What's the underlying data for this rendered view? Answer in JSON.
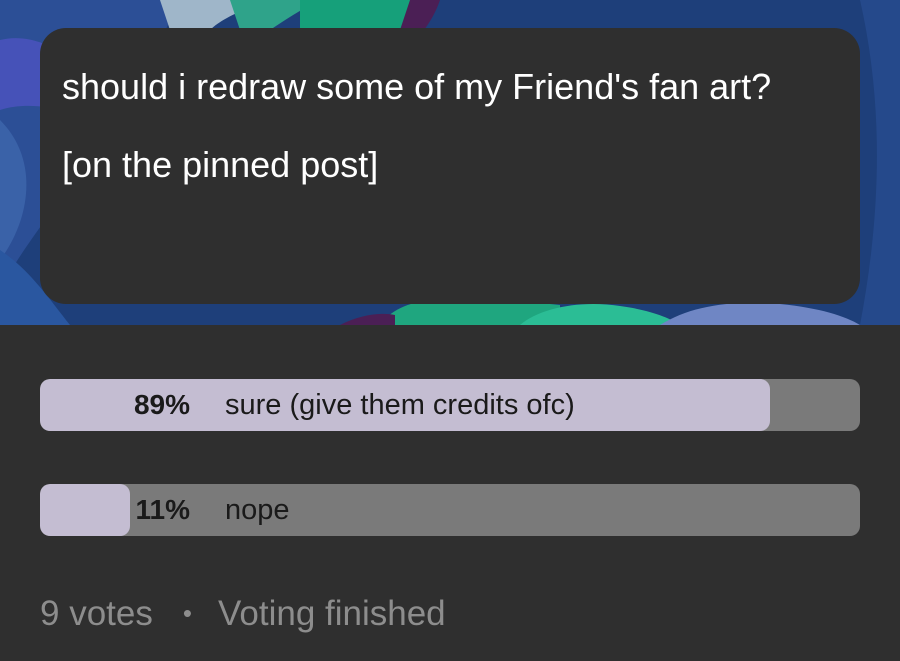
{
  "post": {
    "question": "should i redraw some of my Friend's fan art?",
    "note": "[on the pinned post]"
  },
  "poll": {
    "options": [
      {
        "percent_label": "89%",
        "label": "sure (give them credits ofc)",
        "fraction": 0.89
      },
      {
        "percent_label": "11%",
        "label": "nope",
        "fraction": 0.11
      }
    ],
    "votes": "9 votes",
    "separator": "•",
    "status": "Voting finished"
  },
  "colors": {
    "background": "#2f2f2f",
    "bar_track": "#7a7a7a",
    "bar_fill": "#c4bdd2",
    "footer_text": "#8d8d8d"
  },
  "artwork": {
    "description_icon": "illustration-background"
  }
}
